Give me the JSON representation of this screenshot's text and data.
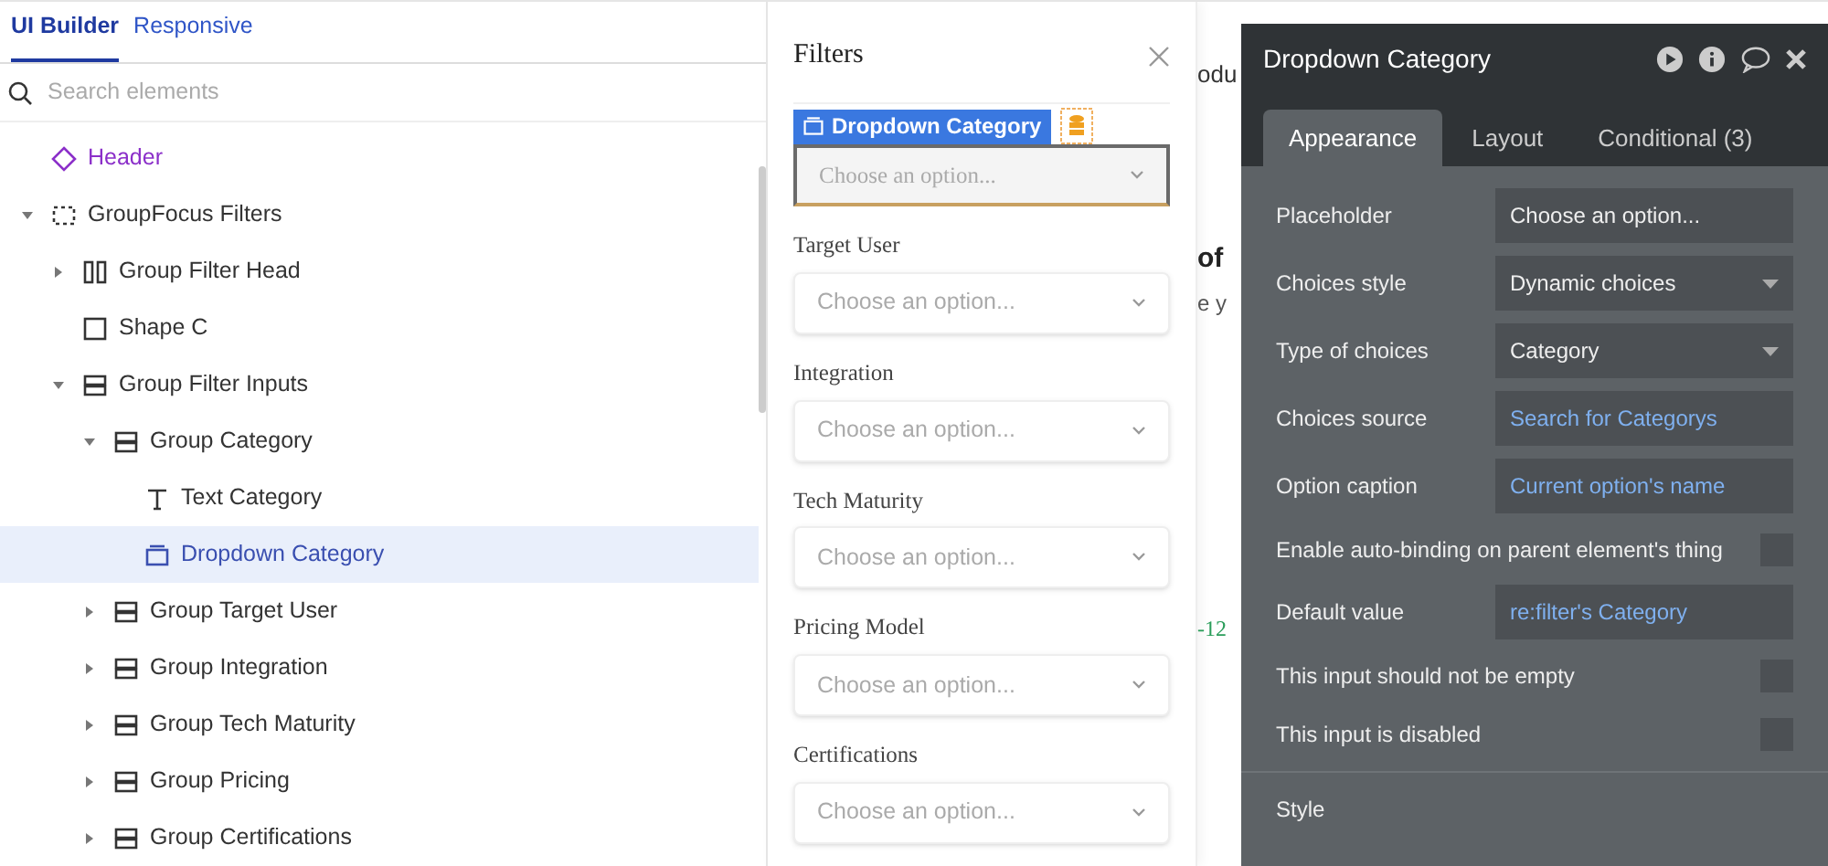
{
  "left_panel": {
    "tabs": [
      {
        "label": "UI Builder",
        "selected": true
      },
      {
        "label": "Responsive",
        "selected": false
      }
    ],
    "search": {
      "placeholder": "Search elements"
    },
    "tree": [
      {
        "label": "Header",
        "kind": "element",
        "selected": false
      },
      {
        "label": "GroupFocus Filters",
        "kind": "focus-group",
        "selected": false,
        "expanded": true,
        "children": [
          {
            "label": "Group Filter Head",
            "kind": "row-group",
            "selected": false,
            "expanded": false
          },
          {
            "label": "Shape C",
            "kind": "shape",
            "selected": false
          },
          {
            "label": "Group Filter Inputs",
            "kind": "column-group",
            "selected": false,
            "expanded": true,
            "children": [
              {
                "label": "Group Category",
                "kind": "column-group",
                "selected": false,
                "expanded": true,
                "children": [
                  {
                    "label": "Text Category",
                    "kind": "text",
                    "selected": false
                  },
                  {
                    "label": "Dropdown Category",
                    "kind": "dropdown",
                    "selected": true
                  }
                ]
              },
              {
                "label": "Group Target User",
                "kind": "column-group",
                "selected": false,
                "expanded": false
              },
              {
                "label": "Group Integration",
                "kind": "column-group",
                "selected": false,
                "expanded": false
              },
              {
                "label": "Group Tech Maturity",
                "kind": "column-group",
                "selected": false,
                "expanded": false
              },
              {
                "label": "Group Pricing",
                "kind": "column-group",
                "selected": false,
                "expanded": false
              },
              {
                "label": "Group Certifications",
                "kind": "column-group",
                "selected": false,
                "expanded": false
              }
            ]
          }
        ]
      }
    ]
  },
  "filters_panel": {
    "title": "Filters",
    "element_tag": "Dropdown Category",
    "fields": [
      {
        "placeholder": "Choose an option...",
        "selected": true
      },
      {
        "label": "Target User",
        "placeholder": "Choose an option...",
        "selected": false
      },
      {
        "label": "Integration",
        "placeholder": "Choose an option...",
        "selected": false
      },
      {
        "label": "Tech Maturity",
        "placeholder": "Choose an option...",
        "selected": false
      },
      {
        "label": "Pricing Model",
        "placeholder": "Choose an option...",
        "selected": false
      },
      {
        "label": "Certifications",
        "placeholder": "Choose an option...",
        "selected": false
      }
    ]
  },
  "canvas_fragments": [
    {
      "text": "odu",
      "kind": "heading"
    },
    {
      "text": "of",
      "kind": "title"
    },
    {
      "text": "e y",
      "kind": "subtitle"
    },
    {
      "text": "-12",
      "kind": "delta"
    }
  ],
  "property_editor": {
    "title": "Dropdown Category",
    "tabs": [
      {
        "label": "Appearance",
        "selected": true
      },
      {
        "label": "Layout",
        "selected": false
      },
      {
        "label": "Conditional (3)",
        "selected": false
      }
    ],
    "properties": [
      {
        "label": "Placeholder",
        "kind": "text",
        "value": "Choose an option..."
      },
      {
        "label": "Choices style",
        "kind": "select",
        "value": "Dynamic choices"
      },
      {
        "label": "Type of choices",
        "kind": "select",
        "value": "Category"
      },
      {
        "label": "Choices source",
        "kind": "expression",
        "value": "Search for Categorys"
      },
      {
        "label": "Option caption",
        "kind": "expression",
        "value": "Current option's name"
      },
      {
        "label": "Enable auto-binding on parent element's thing",
        "kind": "checkbox",
        "checked": false
      },
      {
        "label": "Default value",
        "kind": "expression",
        "value": "re:filter's Category"
      },
      {
        "label": "This input should not be empty",
        "kind": "checkbox",
        "checked": false
      },
      {
        "label": "This input is disabled",
        "kind": "checkbox",
        "checked": false
      }
    ],
    "section": "Style"
  }
}
